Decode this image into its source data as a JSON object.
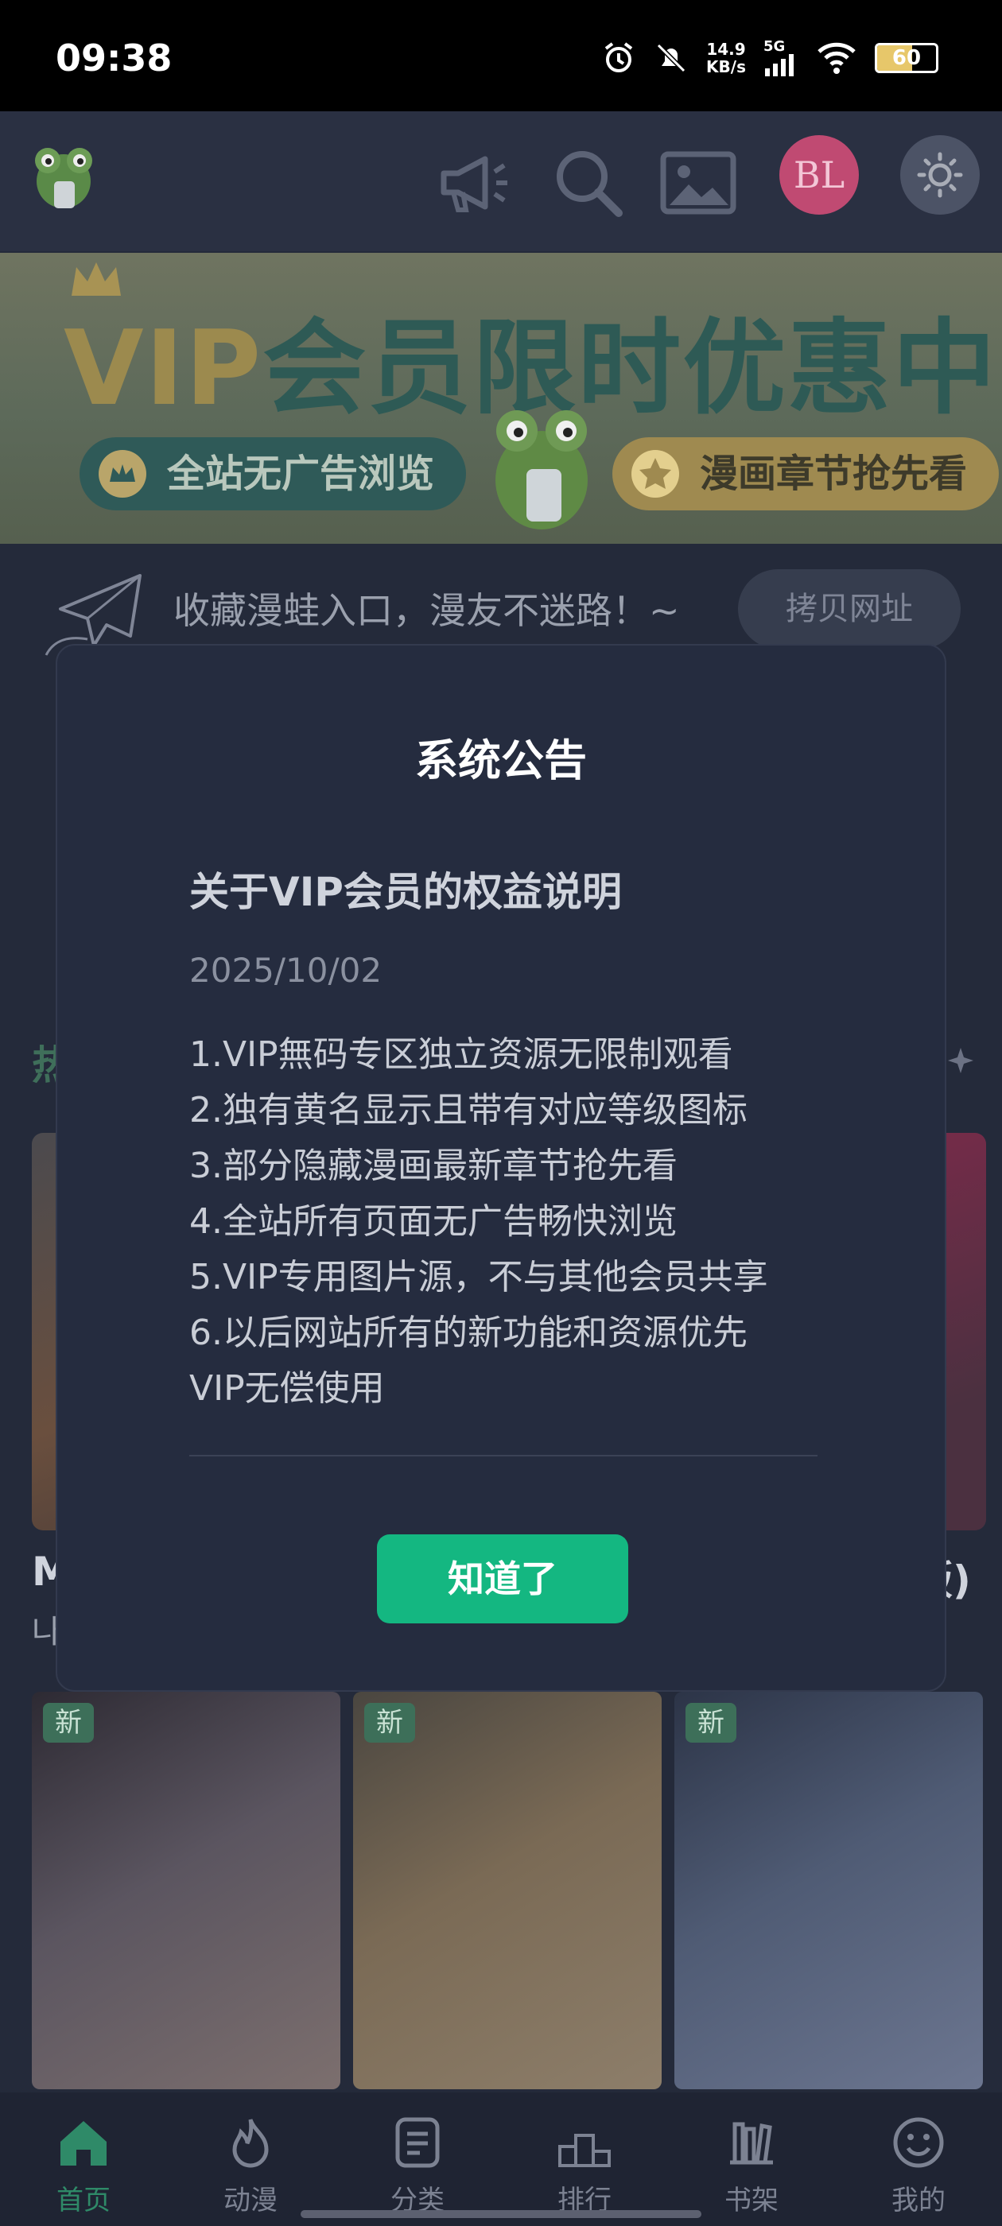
{
  "status_bar": {
    "time": "09:38",
    "net_speed_value": "14.9",
    "net_speed_unit": "KB/s",
    "network": "5G",
    "battery": "60"
  },
  "app_bar": {
    "avatar_text": "BL"
  },
  "banner": {
    "title_latin": "VIP",
    "title_cn": "会员限时优惠中",
    "pill_left": "全站无广告浏览",
    "pill_right": "漫画章节抢先看"
  },
  "notice": {
    "text": "收藏漫蛙入口，漫友不迷路！~",
    "copy_button": "拷贝网址"
  },
  "background": {
    "card_peek_left": "M",
    "card_peek_left_sub": "나",
    "card_peek_right": "版)",
    "new_badge": "新"
  },
  "modal": {
    "title": "系统公告",
    "heading": "关于VIP会员的权益说明",
    "date": "2025/10/02",
    "items": [
      "1.VIP無码专区独立资源无限制观看",
      "2.独有黄名显示且带有对应等级图标",
      "3.部分隐藏漫画最新章节抢先看",
      "4.全站所有页面无广告畅快浏览",
      "5.VIP专用图片源，不与其他会员共享",
      "6.以后网站所有的新功能和资源优先",
      "VIP无偿使用"
    ],
    "confirm_button": "知道了"
  },
  "bottom_nav": {
    "items": [
      {
        "label": "首页",
        "icon": "home-icon"
      },
      {
        "label": "动漫",
        "icon": "flame-icon"
      },
      {
        "label": "分类",
        "icon": "category-icon"
      },
      {
        "label": "排行",
        "icon": "podium-icon"
      },
      {
        "label": "书架",
        "icon": "bookshelf-icon"
      },
      {
        "label": "我的",
        "icon": "smile-icon"
      }
    ]
  },
  "colors": {
    "accent": "#14b781",
    "modal_bg": "#252c3f",
    "page_bg": "#242a3a"
  }
}
